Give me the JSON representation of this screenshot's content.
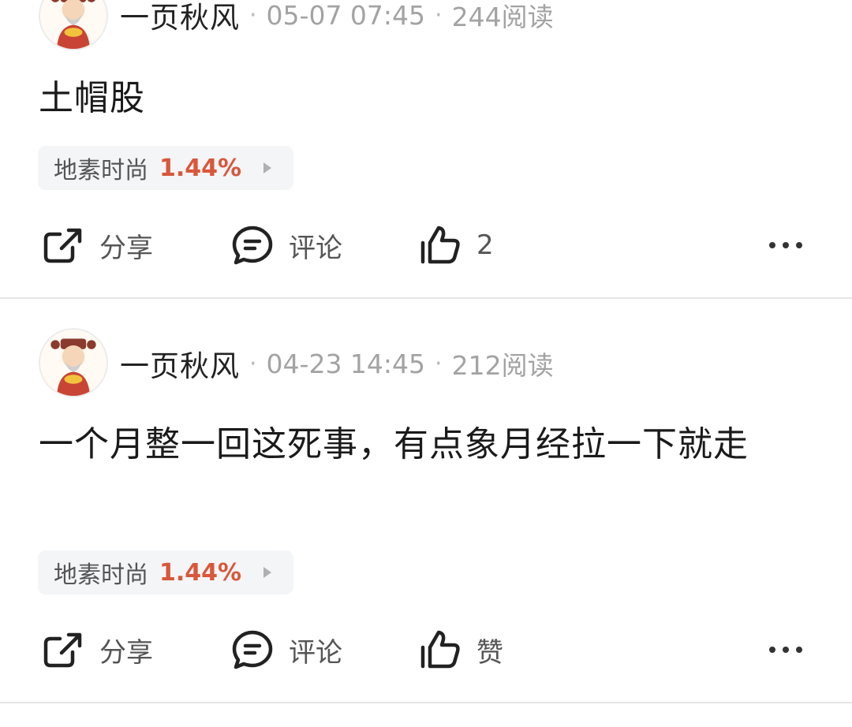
{
  "posts": [
    {
      "author": "一页秋风",
      "date": "05-07 07:45",
      "reads": "244阅读",
      "content": "土帽股",
      "stock": {
        "name": "地素时尚",
        "change": "1.44%"
      },
      "actions": {
        "share": "分享",
        "comment": "评论",
        "like": "2"
      }
    },
    {
      "author": "一页秋风",
      "date": "04-23 14:45",
      "reads": "212阅读",
      "content": "一个月整一回这死事，有点象月经拉一下就走",
      "stock": {
        "name": "地素时尚",
        "change": "1.44%"
      },
      "actions": {
        "share": "分享",
        "comment": "评论",
        "like": "赞"
      }
    }
  ],
  "colors": {
    "stock_up": "#d9573a",
    "meta_gray": "#a3a3a3",
    "tag_bg": "#f4f5f7"
  }
}
